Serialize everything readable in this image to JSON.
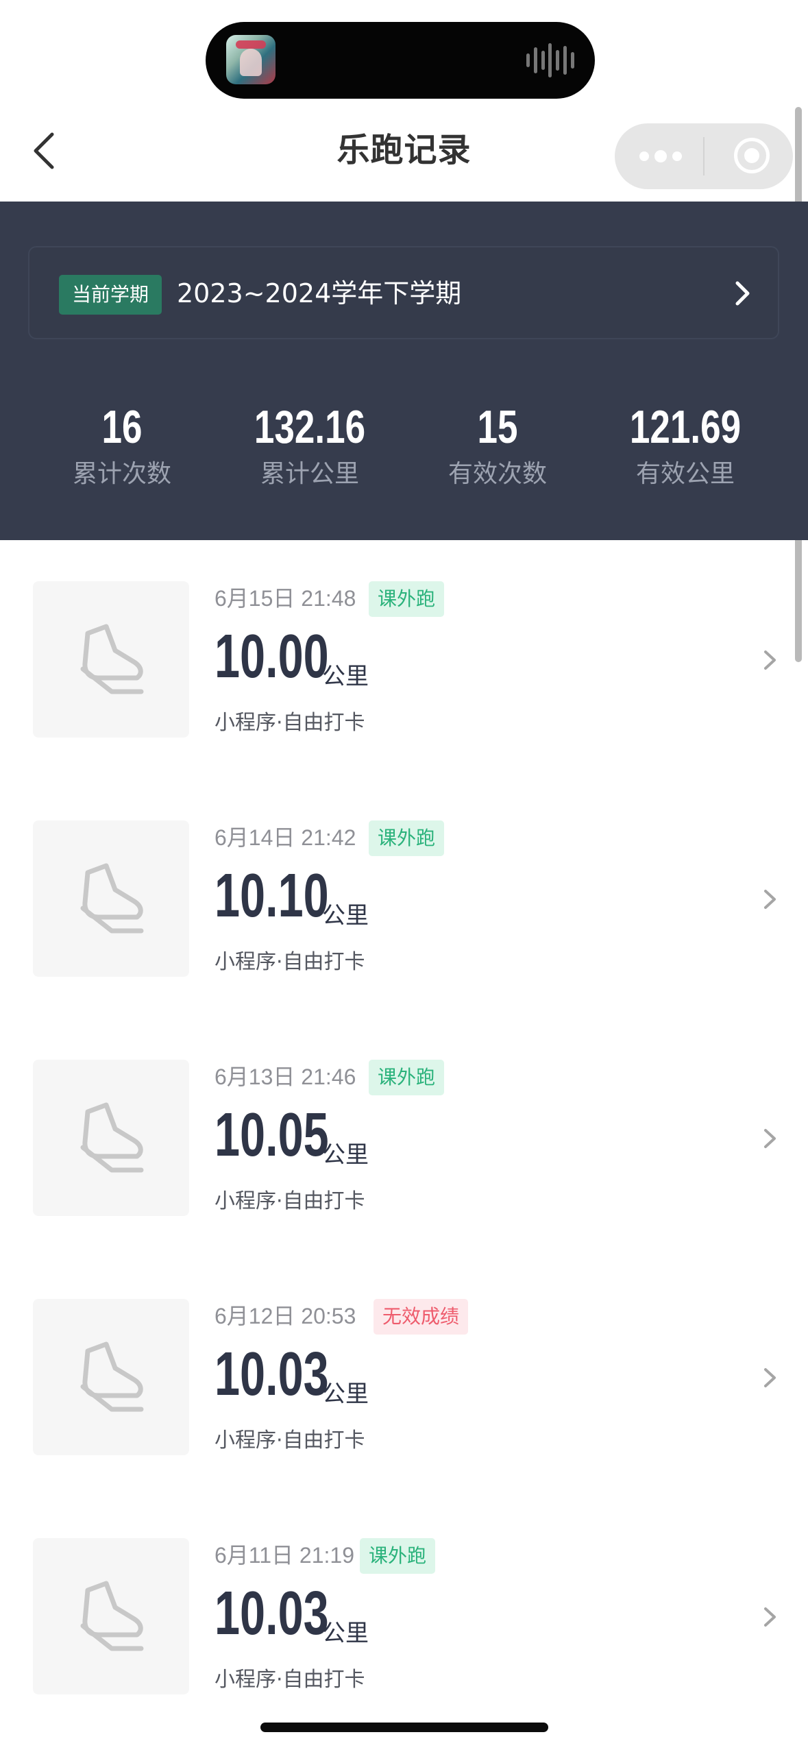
{
  "status": {
    "dynamic_island_media": "album-art",
    "waveform_icon": "waveform-icon"
  },
  "header": {
    "title": "乐跑记录",
    "back_icon": "chevron-left-icon",
    "more_icon": "more-icon",
    "close_icon": "target-icon"
  },
  "summary": {
    "current_badge": "当前学期",
    "semester": "2023~2024学年下学期",
    "arrow_icon": "chevron-right-icon",
    "stats": [
      {
        "value": "16",
        "label": "累计次数"
      },
      {
        "value": "132.16",
        "label": "累计公里"
      },
      {
        "value": "15",
        "label": "有效次数"
      },
      {
        "value": "121.69",
        "label": "有效公里"
      }
    ]
  },
  "records": [
    {
      "time": "6月15日 21:48",
      "tag": "课外跑",
      "tag_color": "#2ab27b",
      "distance": "10.00",
      "unit": "公里",
      "source": "小程序·自由打卡",
      "icon": "shoe-icon"
    },
    {
      "time": "6月14日 21:42",
      "tag": "课外跑",
      "tag_color": "#2ab27b",
      "distance": "10.10",
      "unit": "公里",
      "source": "小程序·自由打卡",
      "icon": "shoe-icon"
    },
    {
      "time": "6月13日 21:46",
      "tag": "课外跑",
      "tag_color": "#2ab27b",
      "distance": "10.05",
      "unit": "公里",
      "source": "小程序·自由打卡",
      "icon": "shoe-icon"
    },
    {
      "time": "6月12日 20:53",
      "tag": "无效成绩",
      "tag_color": "#ee5b6c",
      "distance": "10.03",
      "unit": "公里",
      "source": "小程序·自由打卡",
      "icon": "shoe-icon"
    },
    {
      "time": "6月11日 21:19",
      "tag": "课外跑",
      "tag_color": "#2ab27b",
      "distance": "10.03",
      "unit": "公里",
      "source": "小程序·自由打卡",
      "icon": "shoe-icon"
    }
  ],
  "colors": {
    "summary_background": "#363c4d",
    "active_green": "#2a7a61",
    "record_green": "#2ab27b",
    "invalid_red": "#ee5b6c",
    "text_dark": "#2f3547"
  }
}
